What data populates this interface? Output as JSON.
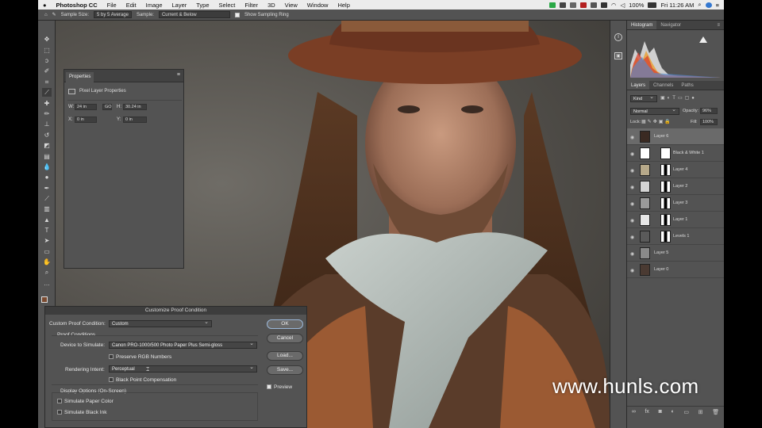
{
  "menubar": {
    "app": "Photoshop CC",
    "items": [
      "File",
      "Edit",
      "Image",
      "Layer",
      "Type",
      "Select",
      "Filter",
      "3D",
      "View",
      "Window",
      "Help"
    ],
    "battery": "100%",
    "clock": "Fri 11:26 AM"
  },
  "options_bar": {
    "sample_size_label": "Sample Size:",
    "sample_size_value": "5 by 5 Average",
    "sample_label": "Sample:",
    "sample_value": "Current & Below",
    "sampling_ring_label": "Show Sampling Ring"
  },
  "properties": {
    "tab": "Properties",
    "subtitle": "Pixel Layer Properties",
    "w_label": "W:",
    "w_value": "24 in",
    "link_label": "GO",
    "h_label": "H:",
    "h_value": "30.24 in",
    "x_label": "X:",
    "x_value": "0 in",
    "y_label": "Y:",
    "y_value": "0 in"
  },
  "histogram_panel": {
    "tabs": [
      "Histogram",
      "Navigator"
    ]
  },
  "layers_panel": {
    "tabs": [
      "Layers",
      "Channels",
      "Paths"
    ],
    "kind_filter": "Kind",
    "blend_mode": "Normal",
    "opacity_label": "Opacity:",
    "opacity_value": "96%",
    "lock_label": "Lock:",
    "fill_label": "Fill:",
    "fill_value": "100%",
    "layers": [
      {
        "name": "Layer 6",
        "selected": true
      },
      {
        "name": "Black & White 1",
        "selected": false
      },
      {
        "name": "Layer 4",
        "selected": false
      },
      {
        "name": "Layer 2",
        "selected": false
      },
      {
        "name": "Layer 3",
        "selected": false
      },
      {
        "name": "Layer 1",
        "selected": false
      },
      {
        "name": "Levels 1",
        "selected": false
      },
      {
        "name": "Layer 5",
        "selected": false
      },
      {
        "name": "Layer 0",
        "selected": false
      }
    ]
  },
  "dialog": {
    "title": "Customize Proof Condition",
    "custom_label": "Custom Proof Condition:",
    "custom_value": "Custom",
    "proof_conditions": "Proof Conditions",
    "device_label": "Device to Simulate:",
    "device_value": "Canon PRO-1000/500 Photo Paper Plus Semi-gloss",
    "preserve_rgb": "Preserve RGB Numbers",
    "intent_label": "Rendering Intent:",
    "intent_value": "Perceptual",
    "black_point": "Black Point Compensation",
    "display_options": "Display Options (On-Screen)",
    "simulate_paper": "Simulate Paper Color",
    "simulate_ink": "Simulate Black Ink",
    "ok": "OK",
    "cancel": "Cancel",
    "load": "Load...",
    "save": "Save...",
    "preview": "Preview"
  },
  "watermark": "www.hunls.com"
}
